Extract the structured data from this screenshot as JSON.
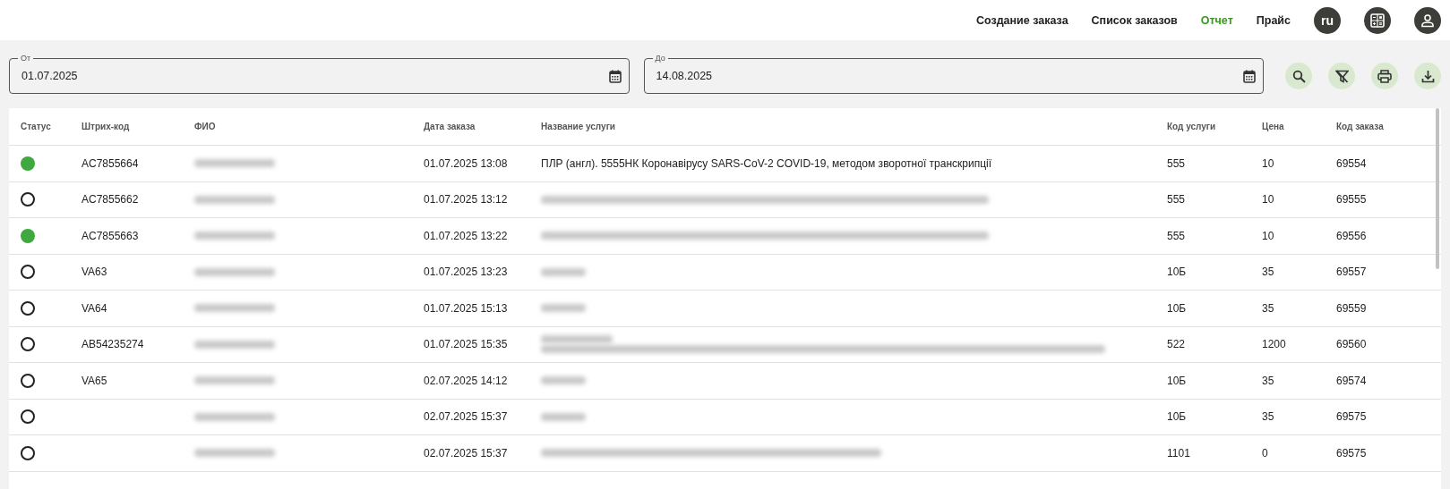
{
  "nav": {
    "items": [
      {
        "label": "Создание заказа",
        "selected": false
      },
      {
        "label": "Список заказов",
        "selected": false
      },
      {
        "label": "Отчет",
        "selected": true
      },
      {
        "label": "Прайс",
        "selected": false
      }
    ],
    "language": "ru"
  },
  "filters": {
    "from": {
      "label": "От",
      "value": "01.07.2025"
    },
    "to": {
      "label": "До",
      "value": "14.08.2025"
    }
  },
  "table": {
    "columns": [
      "Статус",
      "Штрих-код",
      "ФИО",
      "Дата заказа",
      "Название услуги",
      "Код услуги",
      "Цена",
      "Код заказа"
    ],
    "rows": [
      {
        "done": true,
        "barcode": "AC7855664",
        "name_blurred": true,
        "date": "01.07.2025 13:08",
        "service": {
          "kind": "text",
          "text": "ПЛР (англ). 5555НК Коронавірусу SARS-CoV-2 COVID-19, методом зворотної транскрипції"
        },
        "service_code": "555",
        "price": "10",
        "order_code": "69554"
      },
      {
        "done": false,
        "barcode": "AC7855662",
        "name_blurred": true,
        "date": "01.07.2025 13:12",
        "service": {
          "kind": "long"
        },
        "service_code": "555",
        "price": "10",
        "order_code": "69555"
      },
      {
        "done": true,
        "barcode": "AC7855663",
        "name_blurred": true,
        "date": "01.07.2025 13:22",
        "service": {
          "kind": "long"
        },
        "service_code": "555",
        "price": "10",
        "order_code": "69556"
      },
      {
        "done": false,
        "barcode": "VA63",
        "name_blurred": true,
        "date": "01.07.2025 13:23",
        "service": {
          "kind": "short"
        },
        "service_code": "10Б",
        "price": "35",
        "order_code": "69557"
      },
      {
        "done": false,
        "barcode": "VA64",
        "name_blurred": true,
        "date": "01.07.2025 15:13",
        "service": {
          "kind": "short"
        },
        "service_code": "10Б",
        "price": "35",
        "order_code": "69559"
      },
      {
        "done": false,
        "barcode": "AB54235274",
        "name_blurred": true,
        "date": "01.07.2025 15:35",
        "service": {
          "kind": "wrapped"
        },
        "service_code": "522",
        "price": "1200",
        "order_code": "69560"
      },
      {
        "done": false,
        "barcode": "VA65",
        "name_blurred": true,
        "date": "02.07.2025 14:12",
        "service": {
          "kind": "short"
        },
        "service_code": "10Б",
        "price": "35",
        "order_code": "69574"
      },
      {
        "done": false,
        "name_blurred": true,
        "date": "02.07.2025 15:37",
        "service": {
          "kind": "short"
        },
        "service_code": "10Б",
        "price": "35",
        "order_code": "69575"
      },
      {
        "done": false,
        "name_blurred": true,
        "date": "02.07.2025 15:37",
        "service": {
          "kind": "medium"
        },
        "service_code": "1101",
        "price": "0",
        "order_code": "69575"
      }
    ]
  }
}
